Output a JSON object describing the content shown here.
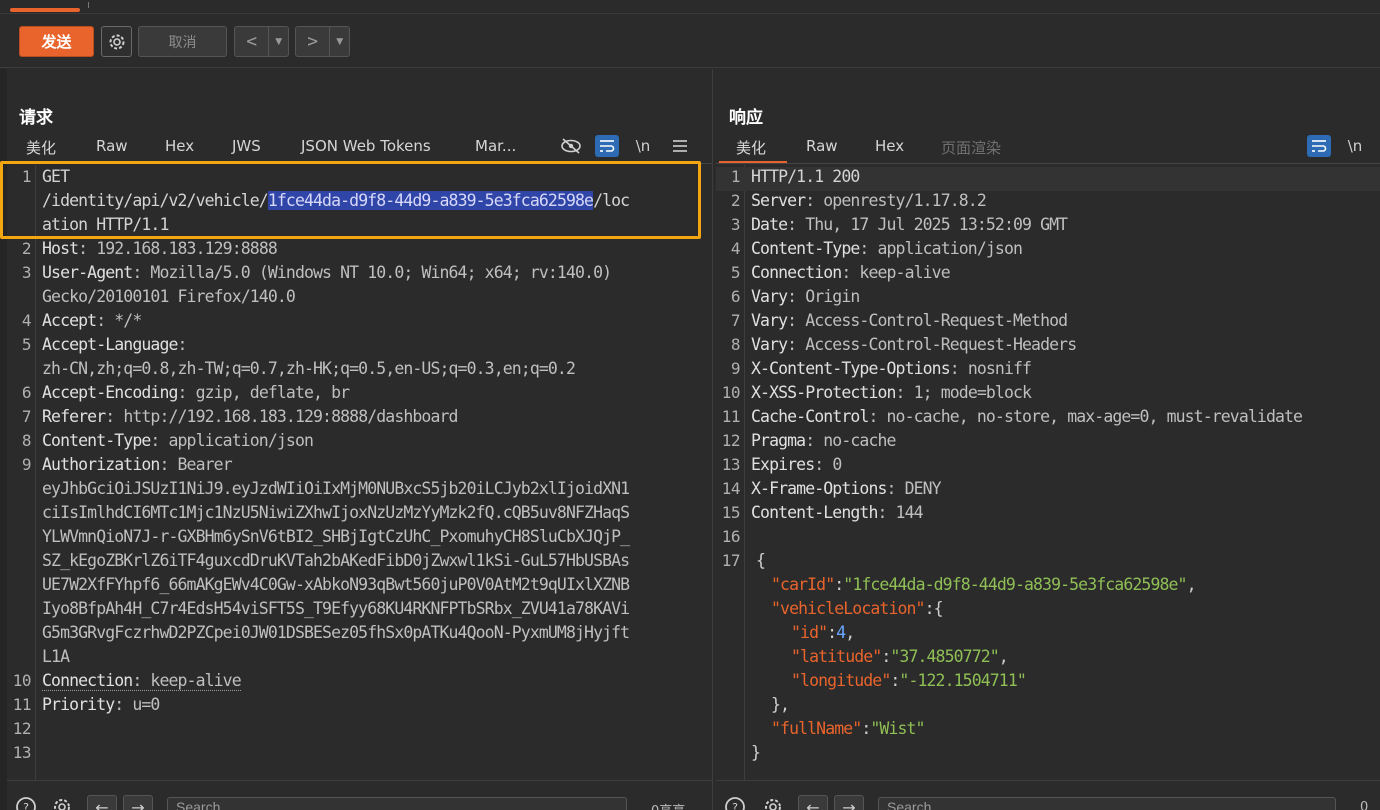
{
  "toolbar": {
    "send_label": "发送",
    "cancel_label": "取消",
    "back_glyph": "<",
    "forward_glyph": ">",
    "dropdown_glyph": "▼"
  },
  "request": {
    "title": "请求",
    "tabs": [
      "美化",
      "Raw",
      "Hex",
      "JWS",
      "JSON Web Tokens",
      "Mar..."
    ],
    "newline_toggle": "\\n"
  },
  "response": {
    "title": "响应",
    "tabs": [
      "美化",
      "Raw",
      "Hex",
      "页面渲染"
    ],
    "newline_toggle": "\\n"
  },
  "request_lines": {
    "l1a": "GET",
    "l1b_pre": "/identity/api/v2/vehicle/",
    "l1b_hl": "1fce44da-d9f8-44d9-a839-5e3fca62598e",
    "l1b_post": "/loc",
    "l1c": "ation HTTP/1.1",
    "l2k": "Host",
    "l2v": ": 192.168.183.129:8888",
    "l3k": "User-Agent",
    "l3v": ": Mozilla/5.0 (Windows NT 10.0; Win64; x64; rv:140.0)",
    "l3c": "Gecko/20100101 Firefox/140.0",
    "l4k": "Accept",
    "l4v": ": */*",
    "l5k": "Accept-Language",
    "l5v": ":",
    "l5c": "zh-CN,zh;q=0.8,zh-TW;q=0.7,zh-HK;q=0.5,en-US;q=0.3,en;q=0.2",
    "l6k": "Accept-Encoding",
    "l6v": ": gzip, deflate, br",
    "l7k": "Referer",
    "l7v": ": http://192.168.183.129:8888/dashboard",
    "l8k": "Content-Type",
    "l8v": ": application/json",
    "l9k": "Authorization",
    "l9v": ": Bearer",
    "tok1": "eyJhbGciOiJSUzI1NiJ9.eyJzdWIiOiIxMjM0NUBxcS5jb20iLCJyb2xlIjoidXN1",
    "tok2": "ciIsImlhdCI6MTc1Mjc1NzU5NiwiZXhwIjoxNzUzMzYyMzk2fQ.cQB5uv8NFZHaqS",
    "tok3": "YLWVmnQioN7J-r-GXBHm6ySnV6tBI2_SHBjIgtCzUhC_PxomuhyCH8SluCbXJQjP_",
    "tok4": "SZ_kEgoZBKrlZ6iTF4guxcdDruKVTah2bAKedFibD0jZwxwl1kSi-GuL57HbUSBAs",
    "tok5": "UE7W2XfFYhpf6_66mAKgEWv4C0Gw-xAbkoN93qBwt560juP0V0AtM2t9qUIxlXZNB",
    "tok6": "Iyo8BfpAh4H_C7r4EdsH54viSFT5S_T9Efyy68KU4RKNFPTbSRbx_ZVU41a78KAVi",
    "tok7": "G5m3GRvgFczrhwD2PZCpei0JW01DSBESez05fhSx0pATKu4QooN-PyxmUM8jHyjft",
    "tok8": "L1A",
    "l10k": "Connection",
    "l10v": ": keep-alive",
    "l11k": "Priority",
    "l11v": ": u=0"
  },
  "response_lines": {
    "r1": "HTTP/1.1 200",
    "r2k": "Server",
    "r2v": ": openresty/1.17.8.2",
    "r3k": "Date",
    "r3v": ": Thu, 17 Jul 2025 13:52:09 GMT",
    "r4k": "Content-Type",
    "r4v": ": application/json",
    "r5k": "Connection",
    "r5v": ": keep-alive",
    "r6k": "Vary",
    "r6v": ": Origin",
    "r7k": "Vary",
    "r7v": ": Access-Control-Request-Method",
    "r8k": "Vary",
    "r8v": ": Access-Control-Request-Headers",
    "r9k": "X-Content-Type-Options",
    "r9v": ": nosniff",
    "r10k": "X-XSS-Protection",
    "r10v": ": 1; mode=block",
    "r11k": "Cache-Control",
    "r11v": ": no-cache, no-store, max-age=0, must-revalidate",
    "r12k": "Pragma",
    "r12v": ": no-cache",
    "r13k": "Expires",
    "r13v": ": 0",
    "r14k": "X-Frame-Options",
    "r14v": ": DENY",
    "r15k": "Content-Length",
    "r15v": ": 144",
    "j_open": "{",
    "j_carId_k": "\"carId\"",
    "j_carId_v": "\"1fce44da-d9f8-44d9-a839-5e3fca62598e\"",
    "j_vl_k": "\"vehicleLocation\"",
    "j_id_k": "\"id\"",
    "j_id_v": "4",
    "j_lat_k": "\"latitude\"",
    "j_lat_v": "\"37.4850772\"",
    "j_lon_k": "\"longitude\"",
    "j_lon_v": "\"-122.1504711\"",
    "j_close_inner": "},",
    "j_fn_k": "\"fullName\"",
    "j_fn_v": "\"Wist\"",
    "j_close": "}"
  },
  "bottom": {
    "search_placeholder": "Search",
    "left_count": "0高亮",
    "right_count": "0"
  },
  "colors": {
    "accent": "#e8642c",
    "highlight_box": "#f3a60f",
    "selection": "#2f45a8",
    "toggle_blue": "#2d6cb5"
  }
}
